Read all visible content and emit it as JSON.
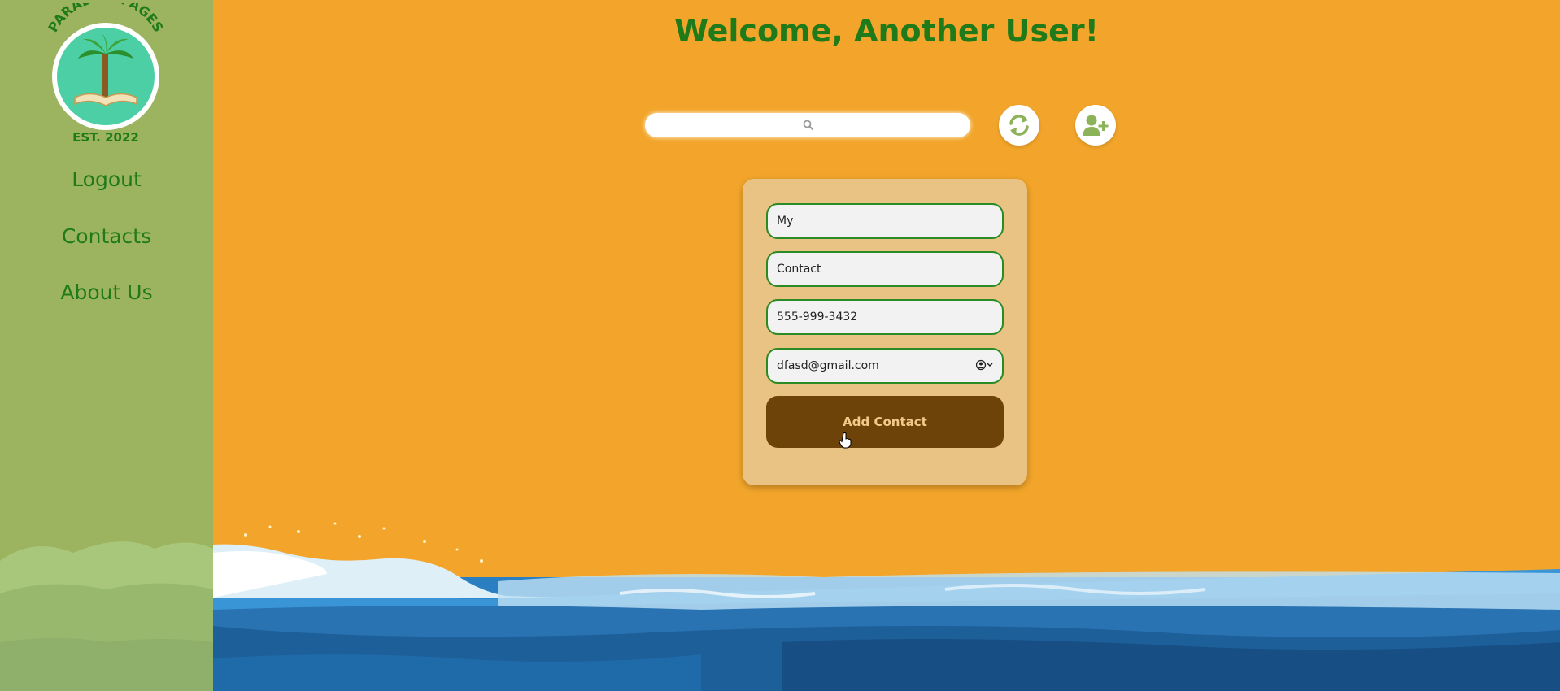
{
  "brand": {
    "top_text": "PARADISE PAGES",
    "bottom_text": "EST. 2022",
    "colors": {
      "green": "#1f7a1a",
      "teal": "#4ccfa4"
    }
  },
  "sidebar": {
    "items": [
      {
        "label": "Logout"
      },
      {
        "label": "Contacts"
      },
      {
        "label": "About Us"
      }
    ]
  },
  "header": {
    "title": "Welcome, Another User!"
  },
  "toolbar": {
    "search": {
      "value": "",
      "placeholder": "",
      "icon": "search-icon"
    },
    "refresh_icon": "refresh-icon",
    "add_user_icon": "add-user-icon"
  },
  "form": {
    "first_name": {
      "value": "My"
    },
    "last_name": {
      "value": "Contact"
    },
    "phone": {
      "value": "555-999-3432"
    },
    "email": {
      "value": "dfasd@gmail.com",
      "icon": "autofill-contact-icon"
    },
    "submit_label": "Add Contact"
  },
  "theme": {
    "background": "#f2a52a",
    "sidebar": "#9cb35f",
    "card": "#e8c383",
    "button": "#6e430a",
    "button_text": "#f3c98a",
    "ocean": "#2a7fc2"
  }
}
